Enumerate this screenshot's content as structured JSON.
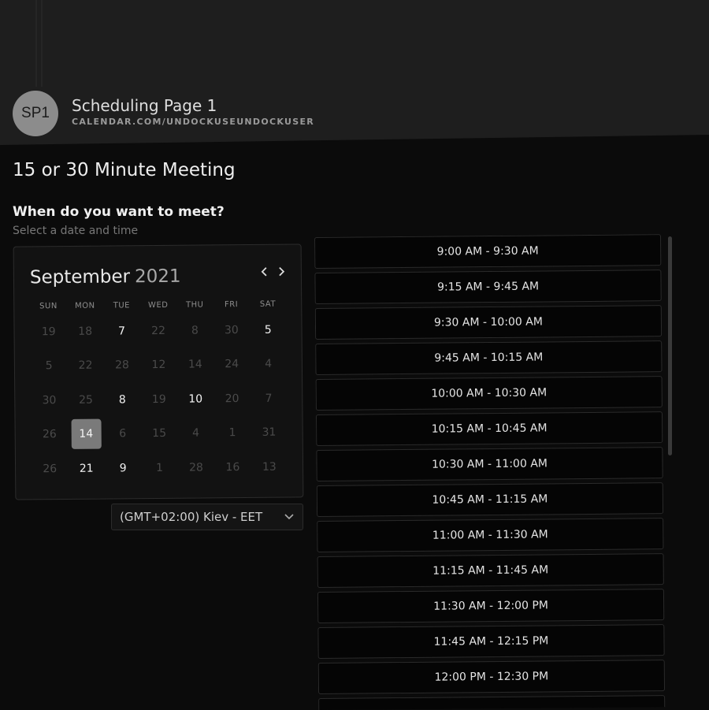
{
  "header": {
    "avatar_initials": "SP1",
    "page_name": "Scheduling Page 1",
    "page_url": "CALENDAR.COM/UNDOCKUSEUNDOCKUSER"
  },
  "meeting": {
    "title": "15 or 30 Minute Meeting",
    "question": "When do you want to meet?",
    "hint": "Select a date and time"
  },
  "calendar": {
    "month": "September",
    "year": "2021",
    "prev_icon": "chevron-left-icon",
    "next_icon": "chevron-right-icon",
    "weekdays": [
      "SUN",
      "MON",
      "TUE",
      "WED",
      "THU",
      "FRI",
      "SAT"
    ],
    "weeks": [
      [
        {
          "d": "19",
          "a": false
        },
        {
          "d": "18",
          "a": false
        },
        {
          "d": "7",
          "a": true
        },
        {
          "d": "22",
          "a": false
        },
        {
          "d": "8",
          "a": false
        },
        {
          "d": "30",
          "a": false
        },
        {
          "d": "5",
          "a": true
        }
      ],
      [
        {
          "d": "5",
          "a": false
        },
        {
          "d": "22",
          "a": false
        },
        {
          "d": "28",
          "a": false
        },
        {
          "d": "12",
          "a": false
        },
        {
          "d": "14",
          "a": false
        },
        {
          "d": "24",
          "a": false
        },
        {
          "d": "4",
          "a": false
        }
      ],
      [
        {
          "d": "30",
          "a": false
        },
        {
          "d": "25",
          "a": false
        },
        {
          "d": "8",
          "a": true
        },
        {
          "d": "19",
          "a": false
        },
        {
          "d": "10",
          "a": true
        },
        {
          "d": "20",
          "a": false
        },
        {
          "d": "7",
          "a": false
        }
      ],
      [
        {
          "d": "26",
          "a": false
        },
        {
          "d": "14",
          "a": true,
          "sel": true
        },
        {
          "d": "6",
          "a": false
        },
        {
          "d": "15",
          "a": false
        },
        {
          "d": "4",
          "a": false
        },
        {
          "d": "1",
          "a": false
        },
        {
          "d": "31",
          "a": false
        }
      ],
      [
        {
          "d": "26",
          "a": false
        },
        {
          "d": "21",
          "a": true
        },
        {
          "d": "9",
          "a": true
        },
        {
          "d": "1",
          "a": false
        },
        {
          "d": "28",
          "a": false
        },
        {
          "d": "16",
          "a": false
        },
        {
          "d": "13",
          "a": false
        }
      ]
    ]
  },
  "timezone": {
    "value": "(GMT+02:00) Kiev - EET",
    "chevron_icon": "chevron-down-icon"
  },
  "time_slots": [
    "9:00 AM - 9:30 AM",
    "9:15 AM - 9:45 AM",
    "9:30 AM - 10:00 AM",
    "9:45 AM - 10:15 AM",
    "10:00 AM - 10:30 AM",
    "10:15 AM - 10:45 AM",
    "10:30 AM - 11:00 AM",
    "10:45 AM - 11:15 AM",
    "11:00 AM - 11:30 AM",
    "11:15 AM - 11:45 AM",
    "11:30 AM - 12:00 PM",
    "11:45 AM - 12:15 PM",
    "12:00 PM - 12:30 PM",
    ""
  ],
  "colors": {
    "background": "#0b0b0b",
    "header": "#1e1e1e",
    "selected_day": "#7a7a7a",
    "avatar": "#8c8c8c"
  }
}
